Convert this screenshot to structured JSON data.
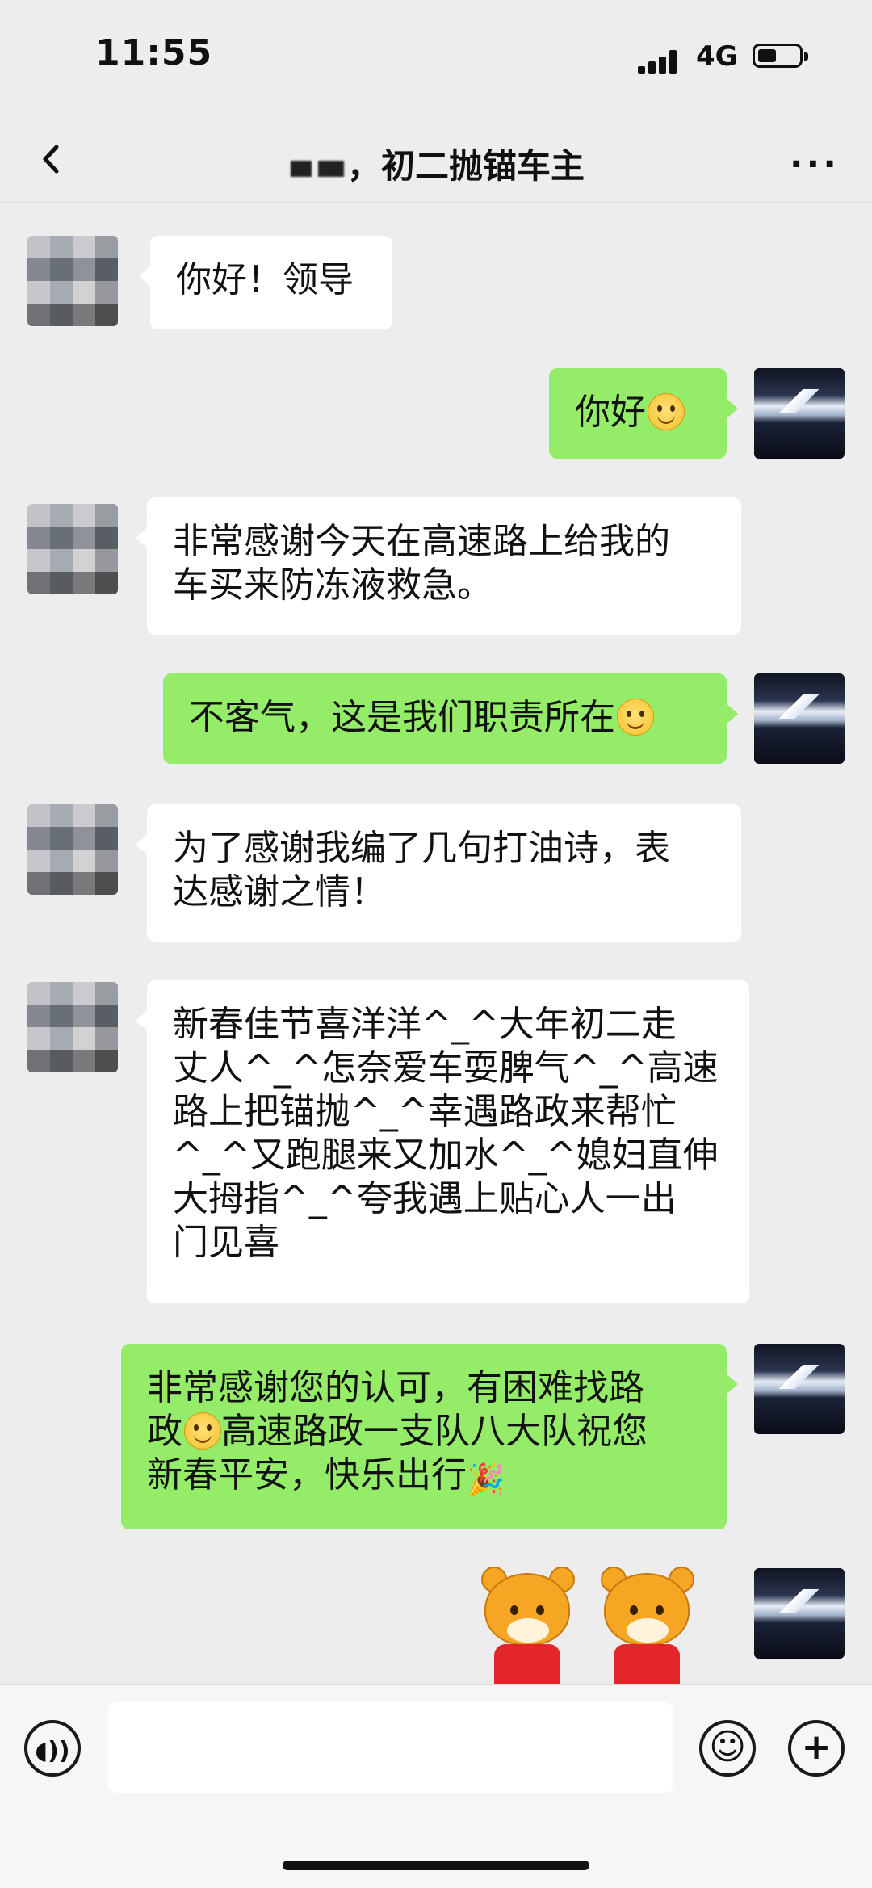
{
  "status_bar": {
    "time": "11:55",
    "network": "4G"
  },
  "nav": {
    "title": "初二抛锚车主",
    "back_icon": "back-arrow-icon",
    "more_label": "···"
  },
  "messages": [
    {
      "from": "other",
      "text": "你好！领导"
    },
    {
      "from": "me",
      "text": "你好",
      "emoji": "smile-emoji"
    },
    {
      "from": "other",
      "lines": [
        "非常感谢今天在高速路上给我的",
        "车买来防冻液救急。"
      ]
    },
    {
      "from": "me",
      "text": "不客气，这是我们职责所在",
      "emoji": "smile-emoji"
    },
    {
      "from": "other",
      "lines": [
        "为了感谢我编了几句打油诗，表",
        "达感谢之情！"
      ]
    },
    {
      "from": "other",
      "lines": [
        "新春佳节喜洋洋^_^大年初二走",
        "丈人^_^怎奈爱车耍脾气^_^高速",
        "路上把锚抛^_^幸遇路政来帮忙",
        "^_^又跑腿来又加水^_^媳妇直伸",
        "大拇指^_^夸我遇上贴心人一出",
        "门见喜"
      ]
    },
    {
      "from": "me",
      "lines_a": [
        "非常感谢您的认可，有困难找路",
        "政"
      ],
      "line2_rest": "高速路政一支队八大队祝您",
      "line3": "新春平安，快乐出行"
    },
    {
      "from": "me",
      "type": "sticker",
      "sticker": "tiger-sticker"
    }
  ],
  "input_bar": {
    "voice_icon": "voice-icon",
    "emoji_icon": "emoji-icon",
    "plus_icon": "plus-icon"
  },
  "colors": {
    "background": "#ededed",
    "my_bubble": "#95ec69",
    "other_bubble": "#ffffff"
  }
}
